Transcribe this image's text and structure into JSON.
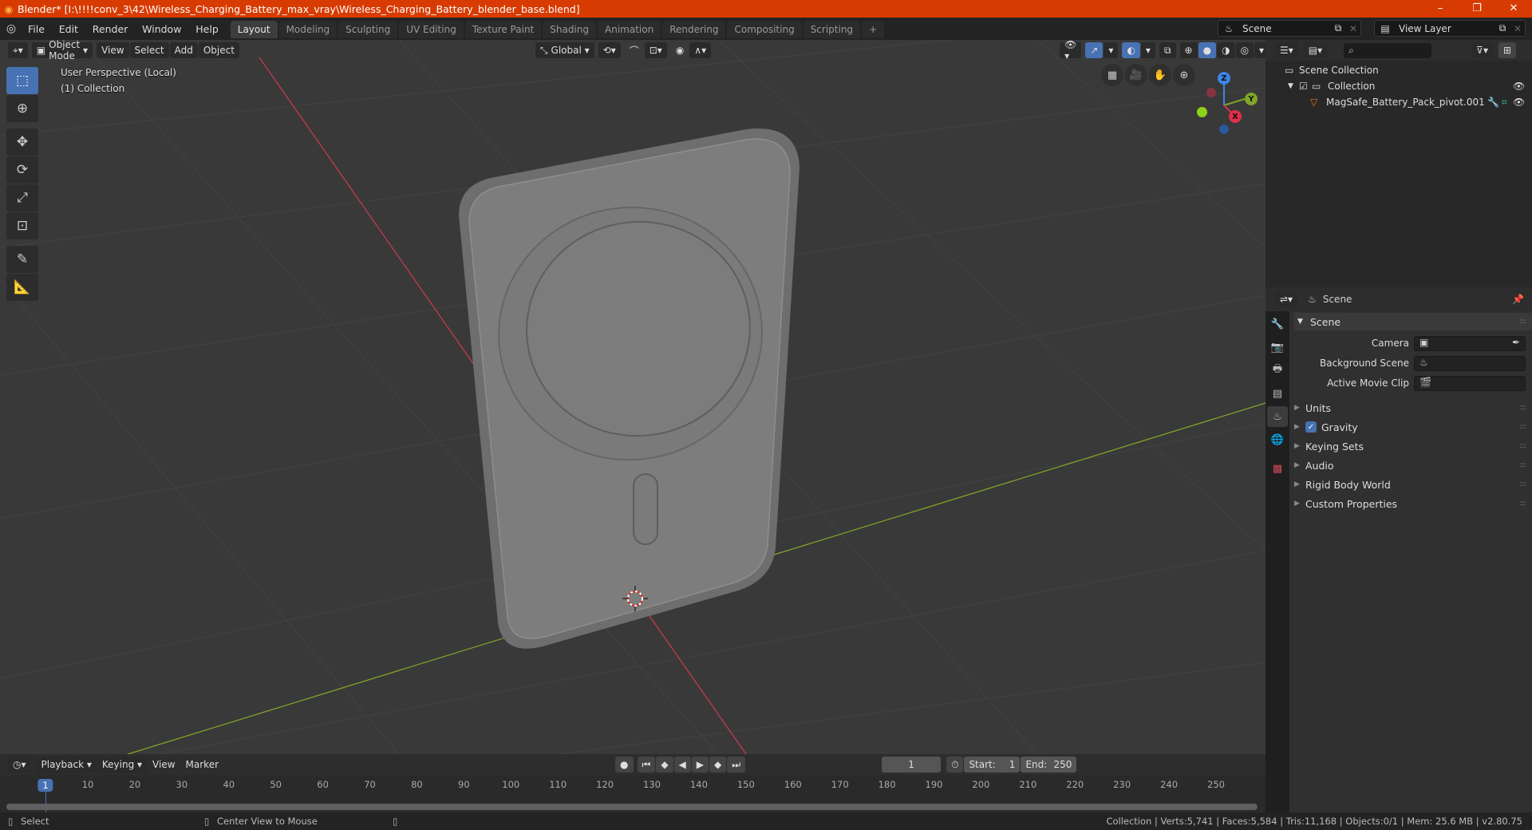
{
  "window": {
    "title": "Blender* [I:\\!!!!conv_3\\42\\Wireless_Charging_Battery_max_vray\\Wireless_Charging_Battery_blender_base.blend]",
    "controls": {
      "minimize": "–",
      "maximize": "❐",
      "close": "✕"
    }
  },
  "menu": [
    "File",
    "Edit",
    "Render",
    "Window",
    "Help"
  ],
  "workspaces": [
    {
      "label": "Layout",
      "active": true
    },
    {
      "label": "Modeling"
    },
    {
      "label": "Sculpting"
    },
    {
      "label": "UV Editing"
    },
    {
      "label": "Texture Paint"
    },
    {
      "label": "Shading"
    },
    {
      "label": "Animation"
    },
    {
      "label": "Rendering"
    },
    {
      "label": "Compositing"
    },
    {
      "label": "Scripting"
    }
  ],
  "add_workspace": "+",
  "scene_selector": {
    "value": "Scene"
  },
  "view_layer_selector": {
    "value": "View Layer"
  },
  "viewport": {
    "mode": "Object Mode",
    "menus": [
      "View",
      "Select",
      "Add",
      "Object"
    ],
    "transform_orientation": "Global",
    "perspective_label": "User Perspective (Local)",
    "collection_label": "(1) Collection",
    "gizmo_axes": {
      "x": "X",
      "y": "Y",
      "z": "Z"
    },
    "colors": {
      "x_axis": "#c8384c",
      "y_axis": "#7fa52a",
      "z_axis": "#3d85e6",
      "model": "#7c7c7c"
    }
  },
  "outliner": {
    "search_placeholder": "",
    "root": "Scene Collection",
    "collection": "Collection",
    "object": "MagSafe_Battery_Pack_pivot.001"
  },
  "properties": {
    "header": "Scene",
    "section": "Scene",
    "fields": [
      {
        "label": "Camera",
        "value": ""
      },
      {
        "label": "Background Scene",
        "value": ""
      },
      {
        "label": "Active Movie Clip",
        "value": ""
      }
    ],
    "panels": [
      {
        "label": "Units"
      },
      {
        "label": "Gravity",
        "checkbox": true,
        "checked": true
      },
      {
        "label": "Keying Sets"
      },
      {
        "label": "Audio"
      },
      {
        "label": "Rigid Body World"
      },
      {
        "label": "Custom Properties"
      }
    ]
  },
  "timeline": {
    "menus": [
      "Playback",
      "Keying",
      "View",
      "Marker"
    ],
    "current_frame": "1",
    "start_label": "Start:",
    "start": "1",
    "end_label": "End:",
    "end": "250",
    "ticks": [
      "1",
      "10",
      "20",
      "30",
      "40",
      "50",
      "60",
      "70",
      "80",
      "90",
      "100",
      "110",
      "120",
      "130",
      "140",
      "150",
      "160",
      "170",
      "180",
      "190",
      "200",
      "210",
      "220",
      "230",
      "240",
      "250"
    ]
  },
  "statusbar": {
    "left_action": "Select",
    "middle_action": "Center View to Mouse",
    "stats": "Collection | Verts:5,741 | Faces:5,584 | Tris:11,168 | Objects:0/1 | Mem: 25.6 MB | v2.80.75"
  }
}
